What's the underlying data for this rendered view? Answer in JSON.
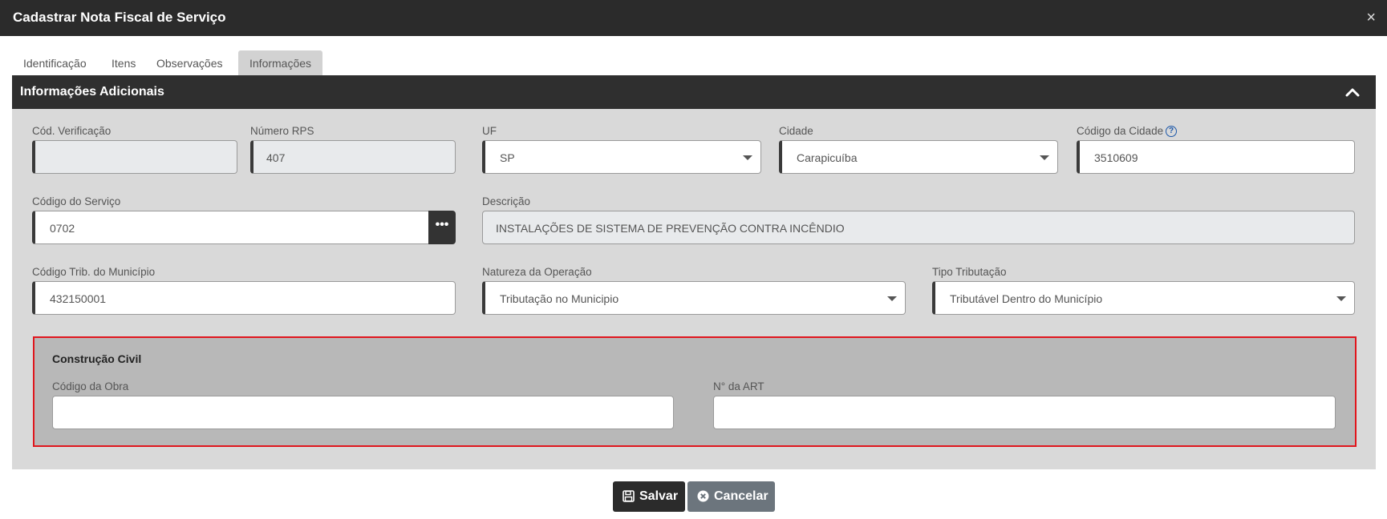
{
  "window": {
    "title": "Cadastrar Nota Fiscal de Serviço",
    "close_label": "×"
  },
  "tabs": [
    {
      "label": "Identificação",
      "active": false
    },
    {
      "label": "Itens",
      "active": false
    },
    {
      "label": "Observações",
      "active": false
    },
    {
      "label": "Informações",
      "active": true
    }
  ],
  "panel": {
    "title": "Informações Adicionais",
    "collapse_icon": "chevron-up-icon"
  },
  "fields": {
    "cod_verificacao": {
      "label": "Cód. Verificação",
      "value": ""
    },
    "numero_rps": {
      "label": "Número RPS",
      "value": "407"
    },
    "uf": {
      "label": "UF",
      "value": "SP"
    },
    "cidade": {
      "label": "Cidade",
      "value": "Carapicuíba"
    },
    "codigo_cidade": {
      "label": "Código da Cidade",
      "value": "3510609",
      "help_icon": "?"
    },
    "codigo_servico": {
      "label": "Código do Serviço",
      "value": "0702",
      "button_label": "•••"
    },
    "descricao": {
      "label": "Descrição",
      "value": "INSTALAÇÕES DE SISTEMA DE PREVENÇÃO CONTRA INCÊNDIO"
    },
    "codigo_trib_municipio": {
      "label": "Código Trib. do Município",
      "value": "432150001"
    },
    "natureza_operacao": {
      "label": "Natureza da Operação",
      "value": "Tributação no Municipio"
    },
    "tipo_tributacao": {
      "label": "Tipo Tributação",
      "value": "Tributável Dentro do Município"
    }
  },
  "construcao_civil": {
    "title": "Construção Civil",
    "codigo_obra": {
      "label": "Código da Obra",
      "value": ""
    },
    "numero_art": {
      "label": "N° da ART",
      "value": ""
    }
  },
  "actions": {
    "save_label": "Salvar",
    "cancel_label": "Cancelar",
    "save_color": "#2b2b2b",
    "cancel_color": "#6c757d"
  },
  "colors": {
    "highlight_border": "#e0161d",
    "header_bg": "#2f2f2f"
  }
}
